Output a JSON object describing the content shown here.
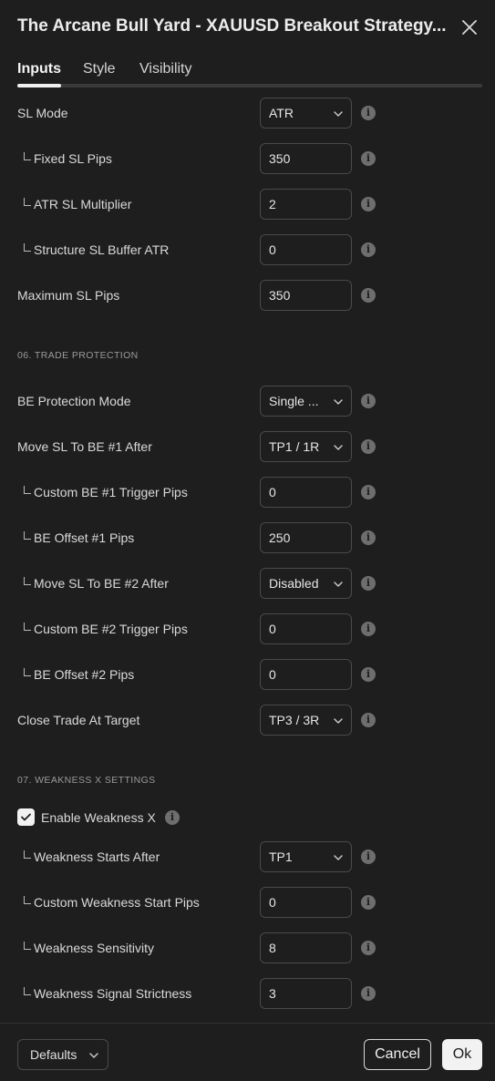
{
  "dialog": {
    "title": "The Arcane Bull Yard - XAUUSD Breakout Strategy...",
    "close_icon": "close-icon"
  },
  "tabs": [
    {
      "label": "Inputs",
      "active": true
    },
    {
      "label": "Style",
      "active": false
    },
    {
      "label": "Visibility",
      "active": false
    }
  ],
  "rows": {
    "sl_mode": {
      "label": "SL Mode",
      "value": "ATR"
    },
    "fixed_sl_pips": {
      "label": "Fixed SL Pips",
      "value": "350"
    },
    "atr_sl_multiplier": {
      "label": "ATR SL Multiplier",
      "value": "2"
    },
    "structure_sl_buffer_atr": {
      "label": "Structure SL Buffer ATR",
      "value": "0"
    },
    "maximum_sl_pips": {
      "label": "Maximum SL Pips",
      "value": "350"
    },
    "section_06": "06. TRADE PROTECTION",
    "be_protection_mode": {
      "label": "BE Protection Mode",
      "value": "Single ..."
    },
    "move_sl_be1_after": {
      "label": "Move SL To BE #1 After",
      "value": "TP1 / 1R"
    },
    "custom_be1_trigger_pips": {
      "label": "Custom BE #1 Trigger Pips",
      "value": "0"
    },
    "be_offset1_pips": {
      "label": "BE Offset #1 Pips",
      "value": "250"
    },
    "move_sl_be2_after": {
      "label": "Move SL To BE #2 After",
      "value": "Disabled"
    },
    "custom_be2_trigger_pips": {
      "label": "Custom BE #2 Trigger Pips",
      "value": "0"
    },
    "be_offset2_pips": {
      "label": "BE Offset #2 Pips",
      "value": "0"
    },
    "close_trade_at_target": {
      "label": "Close Trade At Target",
      "value": "TP3 / 3R"
    },
    "section_07": "07. WEAKNESS X SETTINGS",
    "enable_weakness_x": {
      "label": "Enable Weakness X",
      "checked": true
    },
    "weakness_starts_after": {
      "label": "Weakness Starts After",
      "value": "TP1"
    },
    "custom_weakness_start_pips": {
      "label": "Custom Weakness Start Pips",
      "value": "0"
    },
    "weakness_sensitivity": {
      "label": "Weakness Sensitivity",
      "value": "8"
    },
    "weakness_signal_strictness": {
      "label": "Weakness Signal Strictness",
      "value": "3"
    }
  },
  "info_icon": "info-icon",
  "footer": {
    "defaults_label": "Defaults",
    "cancel_label": "Cancel",
    "ok_label": "Ok"
  },
  "colors": {
    "background": "#1e1e1e",
    "primary_button": "#f2f2f2",
    "border": "#4a4a4a"
  }
}
